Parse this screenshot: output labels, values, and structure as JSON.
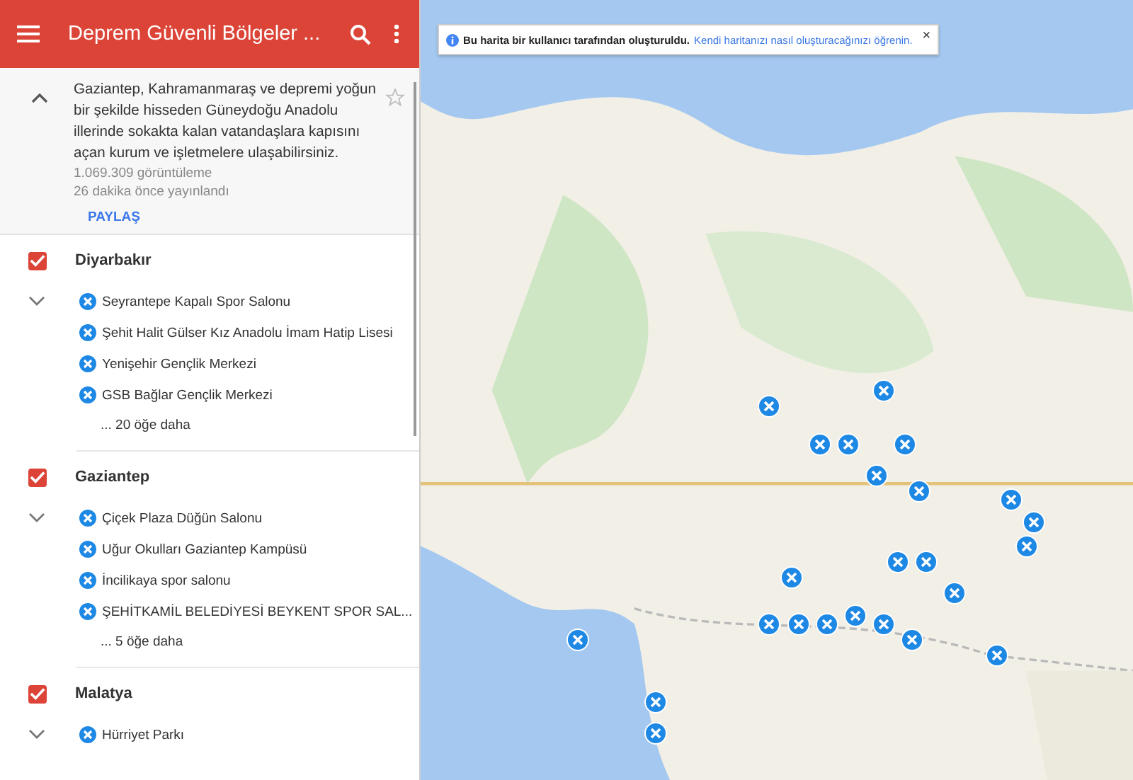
{
  "header": {
    "title": "Deprem Güvenli Bölgeler ..."
  },
  "about": {
    "expanded": true,
    "starred": false,
    "description": "Gaziantep, Kahramanmaraş ve depremi yoğun bir şekilde hisseden Güneydoğu Anadolu illerinde sokakta kalan vatandaşlara kapısını açan kurum ve işletmelere ulaşabilirsiniz.",
    "views": "1.069.309 görüntüleme",
    "published": "26 dakika önce yayınlandı",
    "share": "PAYLAŞ"
  },
  "layers": [
    {
      "name": "Diyarbakır",
      "checked": true,
      "expanded": true,
      "items": [
        "Seyrantepe Kapalı Spor Salonu",
        "Şehit Halit Gülser Kız Anadolu İmam Hatip Lisesi",
        "Yenişehir Gençlik Merkezi",
        "GSB Bağlar Gençlik Merkezi"
      ],
      "more": "... 20 öğe daha"
    },
    {
      "name": "Gaziantep",
      "checked": true,
      "expanded": true,
      "items": [
        "Çiçek Plaza Düğün Salonu",
        "Uğur Okulları Gaziantep Kampüsü",
        "İncilikaya spor salonu",
        "ŞEHİTKAMİL BELEDİYESİ BEYKENT SPOR SAL..."
      ],
      "more": "... 5 öğe daha"
    },
    {
      "name": "Malatya",
      "checked": true,
      "expanded": true,
      "items": [
        "Hürriyet Parkı"
      ]
    }
  ],
  "banner": {
    "text": "Bu harita bir kullanıcı tarafından oluşturuldu.",
    "link": "Kendi haritanızı nasıl oluşturacağınızı öğrenin.",
    "close": "×"
  }
}
